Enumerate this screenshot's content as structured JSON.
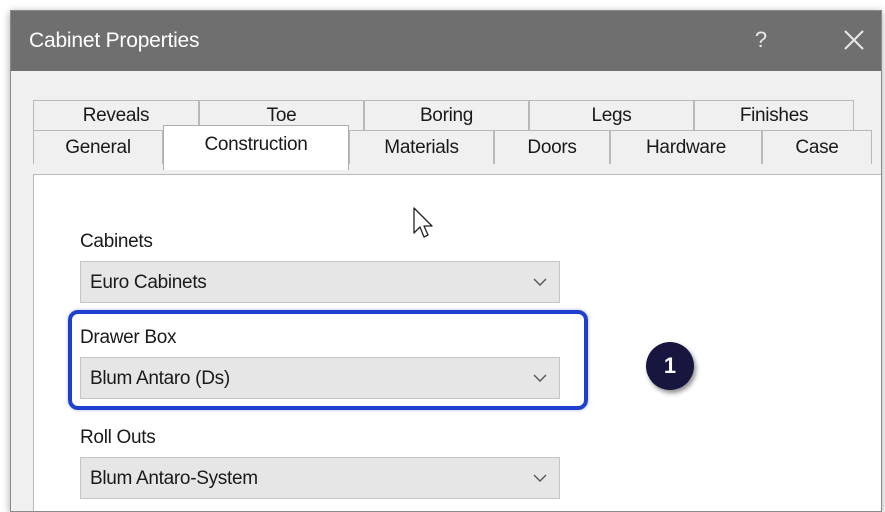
{
  "window": {
    "title": "Cabinet Properties",
    "help_label": "?",
    "close_icon": "close-icon"
  },
  "tabs": {
    "back_row": [
      "Reveals",
      "Toe",
      "Boring",
      "Legs",
      "Finishes"
    ],
    "front_row": [
      "General",
      "Construction",
      "Materials",
      "Doors",
      "Hardware",
      "Case"
    ],
    "active": "Construction"
  },
  "fields": {
    "cabinets": {
      "label": "Cabinets",
      "value": "Euro Cabinets"
    },
    "drawer_box": {
      "label": "Drawer Box",
      "value": "Blum Antaro (Ds)"
    },
    "roll_outs": {
      "label": "Roll Outs",
      "value": "Blum Antaro-System"
    }
  },
  "annotation": {
    "step_number": "1",
    "highlight_color": "#1f3fd0",
    "badge_color": "#16163f"
  }
}
